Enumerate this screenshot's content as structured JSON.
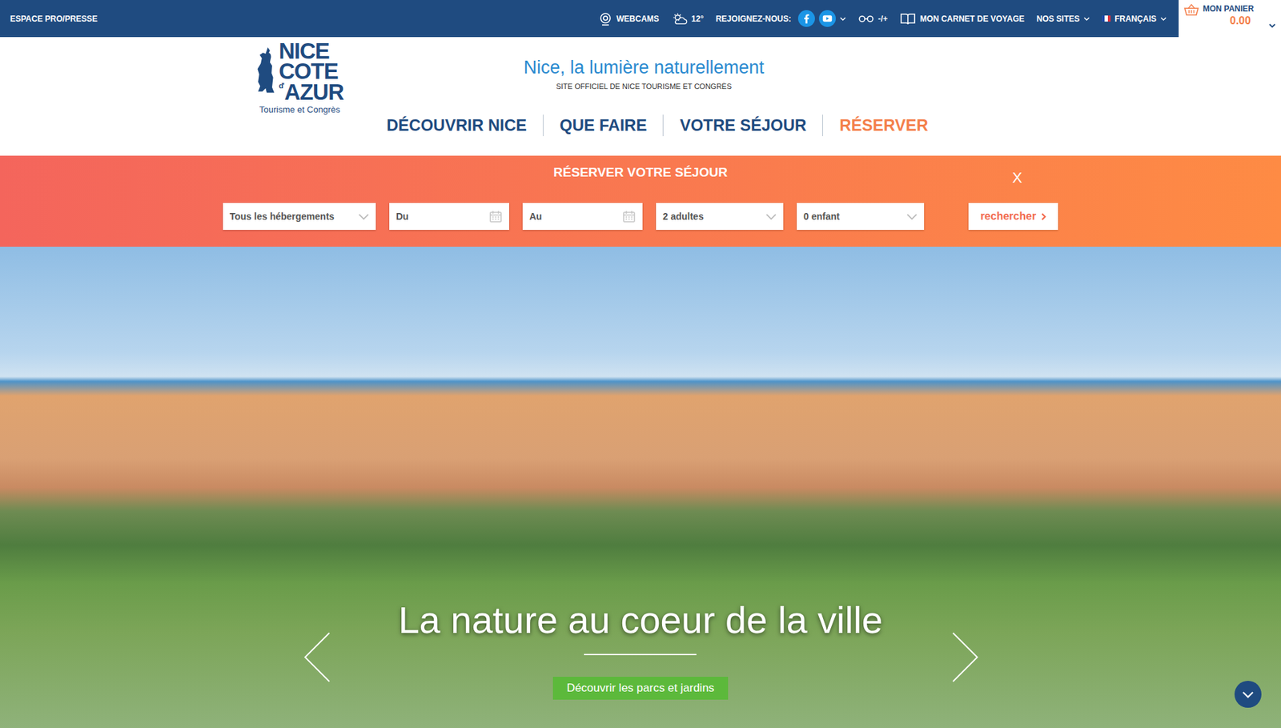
{
  "top_bar": {
    "pro_link": "ESPACE PRO/PRESSE",
    "webcams": "WEBCAMS",
    "weather": "12°",
    "join_label": "REJOIGNEZ-NOUS:",
    "accessibility": "-/+",
    "travel_book": "MON CARNET DE VOYAGE",
    "sites": "NOS SITES",
    "language": "FRANÇAIS",
    "cart": {
      "label": "MON PANIER",
      "total": "0.00"
    }
  },
  "header": {
    "logo": {
      "lines": [
        "NICE",
        "COTE"
      ],
      "small": "d'",
      "last_line": "AZUR",
      "subtitle": "Tourisme et Congrès"
    },
    "tagline": "Nice, la lumière naturellement",
    "site_label": "SITE OFFICIEL DE NICE TOURISME ET CONGRÈS"
  },
  "nav": [
    {
      "label": "DÉCOUVRIR NICE",
      "selected": false
    },
    {
      "label": "QUE FAIRE",
      "selected": false
    },
    {
      "label": "VOTRE SÉJOUR",
      "selected": false
    },
    {
      "label": "RÉSERVER",
      "selected": true
    }
  ],
  "booking": {
    "title": "RÉSERVER VOTRE SÉJOUR",
    "close": "X",
    "fields": [
      {
        "kind": "select",
        "value": "Tous les hébergements"
      },
      {
        "kind": "date",
        "value": "Du"
      },
      {
        "kind": "date",
        "value": "Au"
      },
      {
        "kind": "select",
        "value": "2 adultes"
      },
      {
        "kind": "select",
        "value": "0 enfant"
      }
    ],
    "search_button": "rechercher"
  },
  "hero": {
    "title": "La nature au coeur de la ville",
    "button": "Découvrir les parcs et jardins"
  }
}
